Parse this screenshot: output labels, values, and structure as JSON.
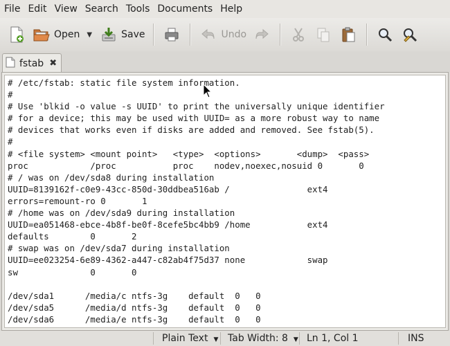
{
  "menubar": {
    "items": [
      "File",
      "Edit",
      "View",
      "Search",
      "Tools",
      "Documents",
      "Help"
    ]
  },
  "toolbar": {
    "open_label": "Open",
    "save_label": "Save",
    "undo_label": "Undo"
  },
  "tab": {
    "title": "fstab"
  },
  "editor": {
    "lines": [
      "# /etc/fstab: static file system information.",
      "#",
      "# Use 'blkid -o value -s UUID' to print the universally unique identifier",
      "# for a device; this may be used with UUID= as a more robust way to name",
      "# devices that works even if disks are added and removed. See fstab(5).",
      "#",
      "# <file system> <mount point>   <type>  <options>       <dump>  <pass>",
      "proc            /proc           proc    nodev,noexec,nosuid 0       0",
      "# / was on /dev/sda8 during installation",
      "UUID=8139162f-c0e9-43cc-850d-30ddbea516ab /               ext4",
      "errors=remount-ro 0       1",
      "# /home was on /dev/sda9 during installation",
      "UUID=ea051468-ebce-4b8f-be0f-8cefe5bc4bb9 /home           ext4",
      "defaults        0       2",
      "# swap was on /dev/sda7 during installation",
      "UUID=ee023254-6e89-4362-a447-c82ab4f75d37 none            swap",
      "sw              0       0",
      "",
      "/dev/sda1      /media/c ntfs-3g    default  0   0",
      "/dev/sda5      /media/d ntfs-3g    default  0   0",
      "/dev/sda6      /media/e ntfs-3g    default  0   0"
    ]
  },
  "statusbar": {
    "language": "Plain Text",
    "tab_width": "Tab Width:  8",
    "position": "Ln 1, Col 1",
    "mode": "INS"
  }
}
